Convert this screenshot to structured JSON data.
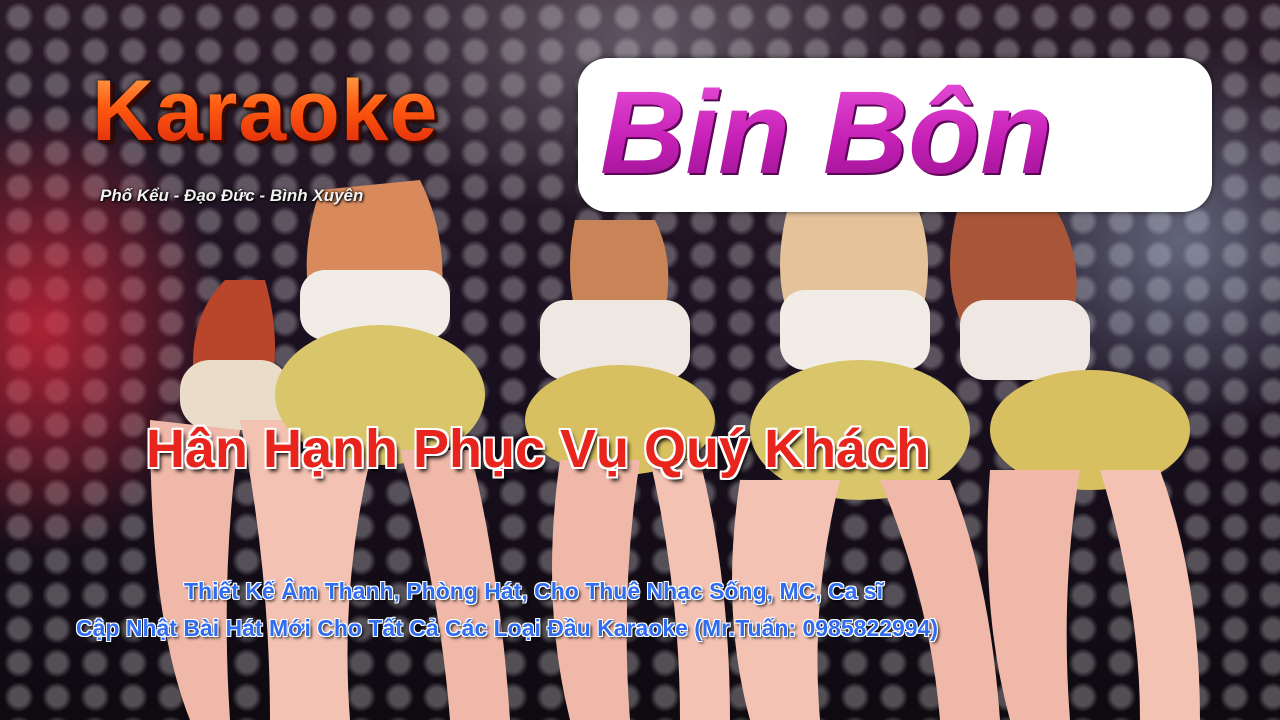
{
  "banner": {
    "title_word": "Karaoke",
    "brand_name": "Bin Bôn",
    "address": "Phố Kểu - Đạo Đức - Bình Xuyên",
    "welcome": "Hân Hạnh Phục Vụ Quý Khách",
    "services": [
      "Thiết Kế Âm Thanh, Phòng Hát, Cho Thuê Nhạc Sống, MC, Ca sĩ",
      "Cập Nhật Bài Hát Mới Cho Tất Cả Các Loại Đầu Karaoke (Mr.Tuấn: 0985822994)"
    ]
  },
  "colors": {
    "karaoke_orange": "#ff5a10",
    "brand_magenta": "#c41fb4",
    "welcome_red": "#e8241c",
    "service_blue": "#2f6cf0"
  }
}
